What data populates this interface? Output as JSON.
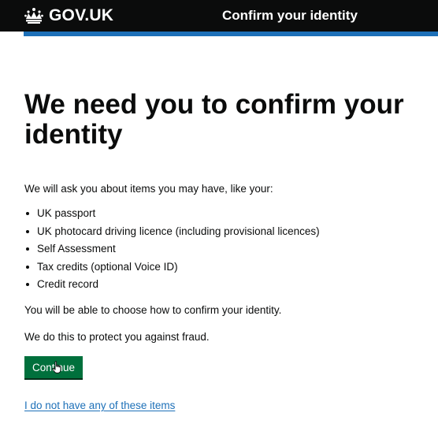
{
  "header": {
    "logo_text": "GOV.UK",
    "service_name": "Confirm your identity",
    "colors": {
      "background": "#0b0c0c",
      "accent_bar": "#1d70b8"
    },
    "logo_icon": "crown-icon"
  },
  "main": {
    "title": "We need you to confirm your identity",
    "intro": "We will ask you about items you may have, like your:",
    "items": [
      "UK passport",
      "UK photocard driving licence (including provisional licences)",
      "Self Assessment",
      "Tax credits (optional Voice ID)",
      "Credit record"
    ],
    "choose_text": "You will be able to choose how to confirm your identity.",
    "protect_text": "We do this to protect you against fraud.",
    "continue_label": "Continue",
    "continue_color": "#00703c",
    "no_items_link": "I do not have any of these items",
    "link_color": "#1d70b8",
    "cursor_icon": "hand-pointer-icon"
  }
}
